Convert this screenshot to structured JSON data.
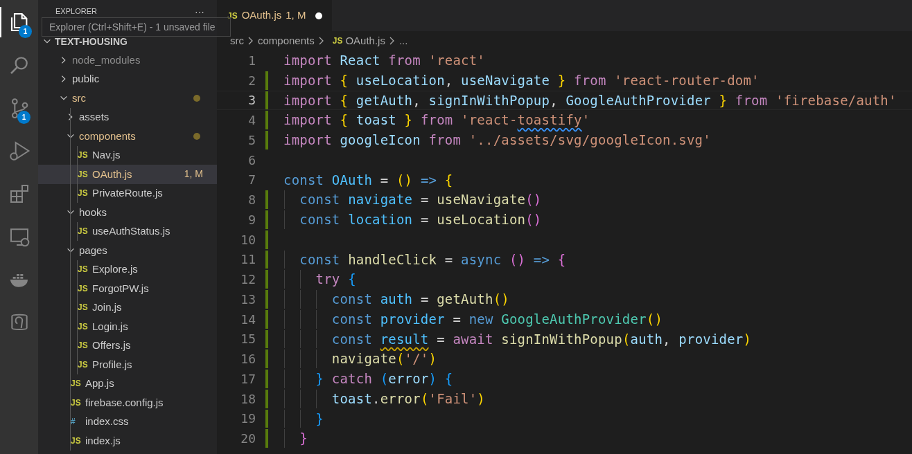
{
  "activity_bar": [
    {
      "selected": true,
      "badge": "1"
    },
    {
      "selected": false
    },
    {
      "selected": false,
      "badge": "1"
    },
    {
      "selected": false
    },
    {
      "selected": false
    },
    {
      "selected": false
    },
    {
      "selected": false
    },
    {
      "selected": false
    }
  ],
  "sidebar": {
    "title": "EXPLORER",
    "more": "···",
    "tooltip": "Explorer (Ctrl+Shift+E) - 1 unsaved file",
    "root": "TEXT-HOUSING",
    "items": [
      {
        "name": "node_modules",
        "kind": "folder",
        "expanded": false,
        "ignored": true,
        "modified": false
      },
      {
        "name": "public",
        "kind": "folder",
        "expanded": false,
        "ignored": false,
        "modified": false
      },
      {
        "name": "src",
        "kind": "folder",
        "expanded": true,
        "ignored": false,
        "modified": true,
        "children": [
          {
            "name": "assets",
            "kind": "folder",
            "expanded": false,
            "ignored": false,
            "modified": false
          },
          {
            "name": "components",
            "kind": "folder",
            "expanded": true,
            "ignored": false,
            "modified": true,
            "children": [
              {
                "name": "Nav.js",
                "kind": "file",
                "glyph": "JS",
                "color": "#cbcb41",
                "ignored": false,
                "modified": false,
                "selected": false
              },
              {
                "name": "OAuth.js",
                "kind": "file",
                "glyph": "JS",
                "color": "#cbcb41",
                "ignored": false,
                "modified": true,
                "decoration": "1, M",
                "selected": true
              },
              {
                "name": "PrivateRoute.js",
                "kind": "file",
                "glyph": "JS",
                "color": "#cbcb41",
                "ignored": false,
                "modified": false,
                "selected": false
              }
            ]
          },
          {
            "name": "hooks",
            "kind": "folder",
            "expanded": true,
            "ignored": false,
            "modified": false,
            "children": [
              {
                "name": "useAuthStatus.js",
                "kind": "file",
                "glyph": "JS",
                "color": "#cbcb41",
                "ignored": false,
                "modified": false,
                "selected": false
              }
            ]
          },
          {
            "name": "pages",
            "kind": "folder",
            "expanded": true,
            "ignored": false,
            "modified": false,
            "children": [
              {
                "name": "Explore.js",
                "kind": "file",
                "glyph": "JS",
                "color": "#cbcb41",
                "ignored": false,
                "modified": false,
                "selected": false
              },
              {
                "name": "ForgotPW.js",
                "kind": "file",
                "glyph": "JS",
                "color": "#cbcb41",
                "ignored": false,
                "modified": false,
                "selected": false
              },
              {
                "name": "Join.js",
                "kind": "file",
                "glyph": "JS",
                "color": "#cbcb41",
                "ignored": false,
                "modified": false,
                "selected": false
              },
              {
                "name": "Login.js",
                "kind": "file",
                "glyph": "JS",
                "color": "#cbcb41",
                "ignored": false,
                "modified": false,
                "selected": false
              },
              {
                "name": "Offers.js",
                "kind": "file",
                "glyph": "JS",
                "color": "#cbcb41",
                "ignored": false,
                "modified": false,
                "selected": false
              },
              {
                "name": "Profile.js",
                "kind": "file",
                "glyph": "JS",
                "color": "#cbcb41",
                "ignored": false,
                "modified": false,
                "selected": false
              }
            ]
          },
          {
            "name": "App.js",
            "kind": "file",
            "glyph": "JS",
            "color": "#cbcb41",
            "ignored": false,
            "modified": false,
            "selected": false
          },
          {
            "name": "firebase.config.js",
            "kind": "file",
            "glyph": "JS",
            "color": "#cbcb41",
            "ignored": false,
            "modified": false,
            "selected": false
          },
          {
            "name": "index.css",
            "kind": "file",
            "glyph": "#",
            "color": "#519aba",
            "ignored": false,
            "modified": false,
            "selected": false
          },
          {
            "name": "index.js",
            "kind": "file",
            "glyph": "JS",
            "color": "#cbcb41",
            "ignored": false,
            "modified": false,
            "selected": false
          }
        ]
      }
    ]
  },
  "tab": {
    "glyph": "JS",
    "label": "OAuth.js",
    "decoration": "1, M",
    "unsaved": true
  },
  "breadcrumbs": [
    {
      "text": "src"
    },
    {
      "text": "components"
    },
    {
      "text": "OAuth.js",
      "glyph": "JS"
    },
    {
      "text": "..."
    }
  ],
  "code": [
    {
      "n": "1",
      "modified": false,
      "current": false,
      "tokens": [
        {
          "kind": "kw",
          "s": "import "
        },
        {
          "kind": "v",
          "s": "React "
        },
        {
          "kind": "kw",
          "s": "from "
        },
        {
          "kind": "s",
          "s": "'react'"
        }
      ]
    },
    {
      "n": "2",
      "modified": true,
      "current": false,
      "tokens": [
        {
          "kind": "kw",
          "s": "import "
        },
        {
          "kind": "b1",
          "s": "{ "
        },
        {
          "kind": "v",
          "s": "useLocation"
        },
        {
          "kind": "p",
          "s": ", "
        },
        {
          "kind": "v",
          "s": "useNavigate "
        },
        {
          "kind": "b1",
          "s": "} "
        },
        {
          "kind": "kw",
          "s": "from "
        },
        {
          "kind": "s",
          "s": "'react-router-dom'"
        }
      ]
    },
    {
      "n": "3",
      "modified": true,
      "current": true,
      "tokens": [
        {
          "kind": "kw",
          "s": "import "
        },
        {
          "kind": "b1",
          "s": "{ "
        },
        {
          "kind": "v",
          "s": "getAuth"
        },
        {
          "kind": "p",
          "s": ", "
        },
        {
          "kind": "v",
          "s": "signInWithPopup"
        },
        {
          "kind": "p",
          "s": ", "
        },
        {
          "kind": "v",
          "s": "GoogleAuthProvider "
        },
        {
          "kind": "b1",
          "s": "} "
        },
        {
          "kind": "kw",
          "s": "from "
        },
        {
          "kind": "s",
          "s": "'firebase/auth'"
        }
      ]
    },
    {
      "n": "4",
      "modified": true,
      "current": false,
      "tokens": [
        {
          "kind": "kw",
          "s": "import "
        },
        {
          "kind": "b1",
          "s": "{ "
        },
        {
          "kind": "v",
          "s": "toast "
        },
        {
          "kind": "b1",
          "s": "} "
        },
        {
          "kind": "kw",
          "s": "from "
        },
        {
          "kind": "s",
          "s": "'react-"
        },
        {
          "kind": "s_info",
          "s": "toastify"
        },
        {
          "kind": "s",
          "s": "'"
        }
      ]
    },
    {
      "n": "5",
      "modified": true,
      "current": false,
      "tokens": [
        {
          "kind": "kw",
          "s": "import "
        },
        {
          "kind": "v",
          "s": "googleIcon "
        },
        {
          "kind": "kw",
          "s": "from "
        },
        {
          "kind": "s",
          "s": "'../assets/svg/googleIcon.svg'"
        }
      ]
    },
    {
      "n": "6",
      "modified": false,
      "current": false
    },
    {
      "n": "7",
      "modified": false,
      "current": false,
      "tokens": [
        {
          "kind": "st",
          "s": "const "
        },
        {
          "kind": "c",
          "s": "OAuth "
        },
        {
          "kind": "p",
          "s": "= "
        },
        {
          "kind": "b1",
          "s": "() "
        },
        {
          "kind": "st",
          "s": "=> "
        },
        {
          "kind": "b1",
          "s": "{"
        }
      ]
    },
    {
      "n": "8",
      "modified": true,
      "current": false,
      "tokens": [
        {
          "kind": "st",
          "s": "  const "
        },
        {
          "kind": "c",
          "s": "navigate "
        },
        {
          "kind": "p",
          "s": "= "
        },
        {
          "kind": "f",
          "s": "useNavigate"
        },
        {
          "kind": "b2",
          "s": "()"
        }
      ]
    },
    {
      "n": "9",
      "modified": true,
      "current": false,
      "tokens": [
        {
          "kind": "st",
          "s": "  const "
        },
        {
          "kind": "c",
          "s": "location "
        },
        {
          "kind": "p",
          "s": "= "
        },
        {
          "kind": "f",
          "s": "useLocation"
        },
        {
          "kind": "b2",
          "s": "()"
        }
      ]
    },
    {
      "n": "10",
      "modified": true,
      "current": false
    },
    {
      "n": "11",
      "modified": true,
      "current": false,
      "tokens": [
        {
          "kind": "st",
          "s": "  const "
        },
        {
          "kind": "f",
          "s": "handleClick "
        },
        {
          "kind": "p",
          "s": "= "
        },
        {
          "kind": "st",
          "s": "async "
        },
        {
          "kind": "b2",
          "s": "() "
        },
        {
          "kind": "st",
          "s": "=> "
        },
        {
          "kind": "b2",
          "s": "{"
        }
      ]
    },
    {
      "n": "12",
      "modified": true,
      "current": false,
      "tokens": [
        {
          "kind": "kw",
          "s": "    try "
        },
        {
          "kind": "b3",
          "s": "{"
        }
      ]
    },
    {
      "n": "13",
      "modified": true,
      "current": false,
      "tokens": [
        {
          "kind": "st",
          "s": "      const "
        },
        {
          "kind": "c",
          "s": "auth "
        },
        {
          "kind": "p",
          "s": "= "
        },
        {
          "kind": "f",
          "s": "getAuth"
        },
        {
          "kind": "b1",
          "s": "()"
        }
      ]
    },
    {
      "n": "14",
      "modified": true,
      "current": false,
      "tokens": [
        {
          "kind": "st",
          "s": "      const "
        },
        {
          "kind": "c",
          "s": "provider "
        },
        {
          "kind": "p",
          "s": "= "
        },
        {
          "kind": "st",
          "s": "new "
        },
        {
          "kind": "cl",
          "s": "GoogleAuthProvider"
        },
        {
          "kind": "b1",
          "s": "()"
        }
      ]
    },
    {
      "n": "15",
      "modified": true,
      "current": false,
      "tokens": [
        {
          "kind": "st",
          "s": "      const "
        },
        {
          "kind": "c_warning",
          "s": "result"
        },
        {
          "kind": "p",
          "s": " = "
        },
        {
          "kind": "kw",
          "s": "await "
        },
        {
          "kind": "f",
          "s": "signInWithPopup"
        },
        {
          "kind": "b1",
          "s": "("
        },
        {
          "kind": "v",
          "s": "auth"
        },
        {
          "kind": "p",
          "s": ", "
        },
        {
          "kind": "v",
          "s": "provider"
        },
        {
          "kind": "b1",
          "s": ")"
        }
      ]
    },
    {
      "n": "16",
      "modified": true,
      "current": false,
      "tokens": [
        {
          "kind": "f",
          "s": "      navigate"
        },
        {
          "kind": "b1",
          "s": "("
        },
        {
          "kind": "s",
          "s": "'/'"
        },
        {
          "kind": "b1",
          "s": ")"
        }
      ]
    },
    {
      "n": "17",
      "modified": true,
      "current": false,
      "tokens": [
        {
          "kind": "b3",
          "s": "    } "
        },
        {
          "kind": "kw",
          "s": "catch "
        },
        {
          "kind": "b3",
          "s": "("
        },
        {
          "kind": "v",
          "s": "error"
        },
        {
          "kind": "b3",
          "s": ") "
        },
        {
          "kind": "b3",
          "s": "{"
        }
      ]
    },
    {
      "n": "18",
      "modified": true,
      "current": false,
      "tokens": [
        {
          "kind": "v",
          "s": "      toast"
        },
        {
          "kind": "p",
          "s": "."
        },
        {
          "kind": "f",
          "s": "error"
        },
        {
          "kind": "b1",
          "s": "("
        },
        {
          "kind": "s",
          "s": "'Fail'"
        },
        {
          "kind": "b1",
          "s": ")"
        }
      ]
    },
    {
      "n": "19",
      "modified": true,
      "current": false,
      "tokens": [
        {
          "kind": "b3",
          "s": "    }"
        }
      ]
    },
    {
      "n": "20",
      "modified": true,
      "current": false,
      "tokens": [
        {
          "kind": "b2",
          "s": "  }"
        }
      ]
    }
  ]
}
